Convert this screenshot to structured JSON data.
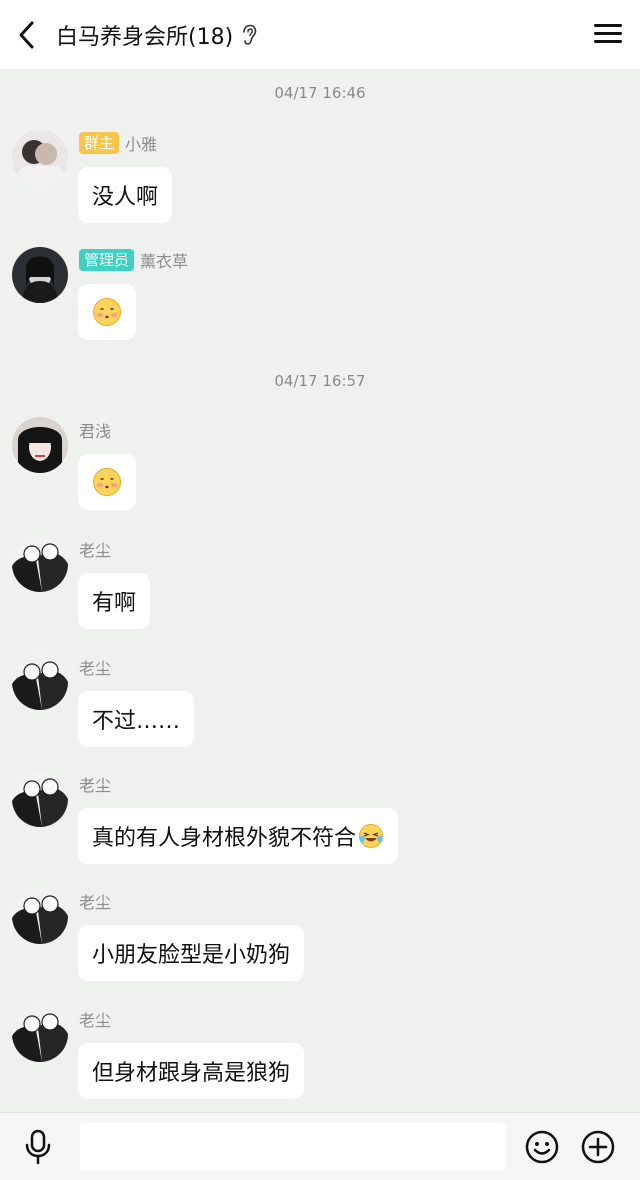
{
  "header": {
    "title": "白马养身会所(18)"
  },
  "chat": {
    "timestamps": [
      "04/17 16:46",
      "04/17 16:57"
    ],
    "messages": [
      {
        "badge": "群主",
        "sender": "小雅",
        "text": "没人啊"
      },
      {
        "badge": "管理员",
        "sender": "薰衣草",
        "text": ""
      },
      {
        "sender": "君浅",
        "text": ""
      },
      {
        "sender": "老尘",
        "text": "有啊"
      },
      {
        "sender": "老尘",
        "text": "不过……"
      },
      {
        "sender": "老尘",
        "text": "真的有人身材根外貌不符合"
      },
      {
        "sender": "老尘",
        "text": "小朋友脸型是小奶狗"
      },
      {
        "sender": "老尘",
        "text": "但身材跟身高是狼狗"
      }
    ]
  },
  "input": {
    "value": "",
    "placeholder": ""
  },
  "colors": {
    "owner_badge": "#f6c54a",
    "admin_badge": "#3fd0c4",
    "background": "#eef1ee"
  }
}
